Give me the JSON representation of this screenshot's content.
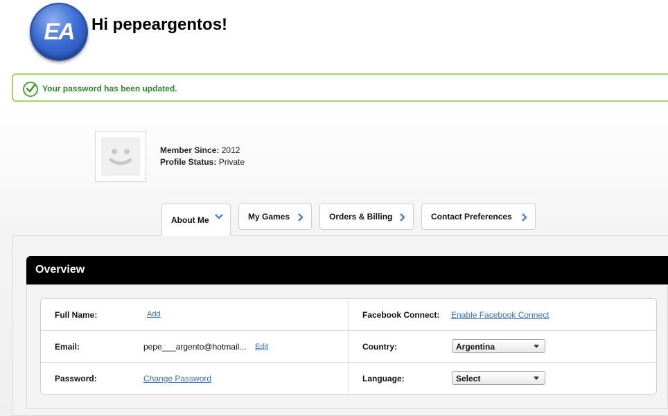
{
  "header": {
    "logo_text": "EA",
    "greeting": "Hi pepeargentos!"
  },
  "banner": {
    "message": "Your password has been updated."
  },
  "profile": {
    "member_since_label": "Member Since:",
    "member_since_value": "2012",
    "status_label": "Profile Status:",
    "status_value": "Private"
  },
  "tabs": [
    {
      "label": "About Me",
      "active": true
    },
    {
      "label": "My Games",
      "active": false
    },
    {
      "label": "Orders & Billing",
      "active": false
    },
    {
      "label": "Contact Preferences",
      "active": false
    }
  ],
  "overview": {
    "title": "Overview",
    "full_name_label": "Full Name:",
    "full_name_action": "Add",
    "email_label": "Email:",
    "email_value": "pepe___argento@hotmail...",
    "email_action": "Edit",
    "password_label": "Password:",
    "password_action": "Change Password",
    "facebook_label": "Facebook Connect:",
    "facebook_action": "Enable Facebook Connect",
    "country_label": "Country:",
    "country_value": "Argentina",
    "language_label": "Language:",
    "language_value": "Select"
  },
  "colors": {
    "success_border": "#a6d36b",
    "success_text": "#2e8a2e",
    "link": "#3a6fb5",
    "tab_arrow": "#4a7fd0",
    "overview_bar": "#000000"
  }
}
